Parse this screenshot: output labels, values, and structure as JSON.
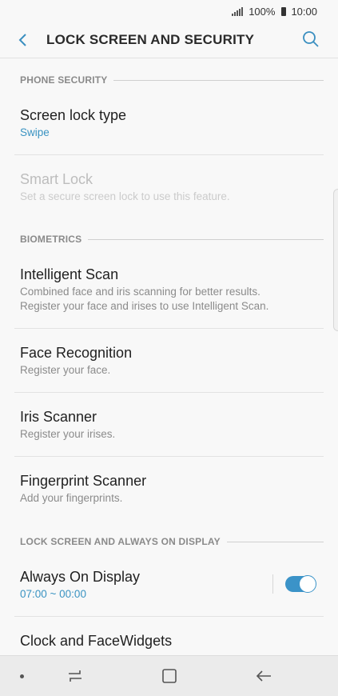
{
  "status_bar": {
    "battery": "100%",
    "time": "10:00"
  },
  "header": {
    "title": "LOCK SCREEN AND SECURITY"
  },
  "sections": {
    "phone_security": "PHONE SECURITY",
    "biometrics": "BIOMETRICS",
    "lock_screen": "LOCK SCREEN AND ALWAYS ON DISPLAY"
  },
  "items": {
    "screen_lock": {
      "title": "Screen lock type",
      "summary": "Swipe"
    },
    "smart_lock": {
      "title": "Smart Lock",
      "summary": "Set a secure screen lock to use this feature."
    },
    "intelligent_scan": {
      "title": "Intelligent Scan",
      "summary_1": "Combined face and iris scanning for better results.",
      "summary_2": "Register your face and irises to use Intelligent Scan."
    },
    "face_recognition": {
      "title": "Face Recognition",
      "summary": "Register your face."
    },
    "iris_scanner": {
      "title": "Iris Scanner",
      "summary": "Register your irises."
    },
    "fingerprint_scanner": {
      "title": "Fingerprint Scanner",
      "summary": "Add your fingerprints."
    },
    "always_on_display": {
      "title": "Always On Display",
      "summary": "07:00 ~ 00:00",
      "enabled": true
    },
    "clock_facewidgets": {
      "title": "Clock and FaceWidgets"
    }
  },
  "colors": {
    "accent": "#3a93c2",
    "toggle_on": "#3b93c8",
    "background": "#f8f8f8"
  },
  "icons": [
    "back-arrow-icon",
    "search-icon",
    "recents-icon",
    "home-icon",
    "back-icon"
  ]
}
